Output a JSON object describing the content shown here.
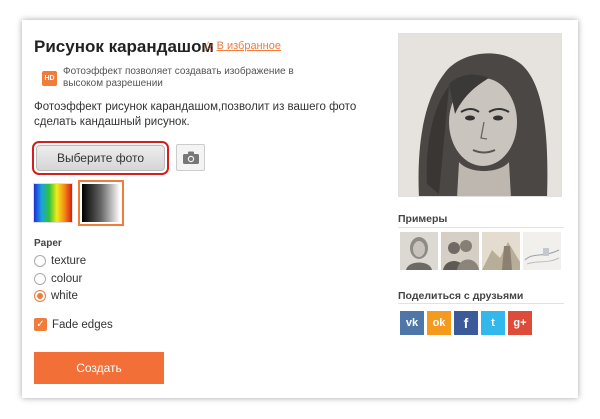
{
  "header": {
    "title": "Рисунок карандашом",
    "favorite_label": "В избранное"
  },
  "hd": {
    "badge": "HD",
    "text": "Фотоэффект позволяет создавать изображение в высоком разрешении"
  },
  "description": "Фотоэффект рисунок карандашом,позволит из вашего фото сделать кандашный рисунок.",
  "buttons": {
    "choose_photo": "Выберите фото",
    "create": "Создать"
  },
  "paper": {
    "label": "Paper",
    "options": [
      {
        "label": "texture",
        "selected": false
      },
      {
        "label": "colour",
        "selected": false
      },
      {
        "label": "white",
        "selected": true
      }
    ]
  },
  "fade_edges": {
    "label": "Fade edges",
    "checked": true
  },
  "examples": {
    "label": "Примеры"
  },
  "share": {
    "label": "Поделиться с друзьями",
    "networks": [
      {
        "name": "vk",
        "glyph": "vk",
        "color": "#4f76a8"
      },
      {
        "name": "odnoklassniki",
        "glyph": "ok",
        "color": "#f59a1c"
      },
      {
        "name": "facebook",
        "glyph": "f",
        "color": "#3b5a9a"
      },
      {
        "name": "twitter",
        "glyph": "t",
        "color": "#32b8ec"
      },
      {
        "name": "google-plus",
        "glyph": "g+",
        "color": "#dd4b39"
      }
    ]
  },
  "colors": {
    "accent": "#f07c3b",
    "button_primary": "#f26f38",
    "highlight": "#d51f1f"
  }
}
